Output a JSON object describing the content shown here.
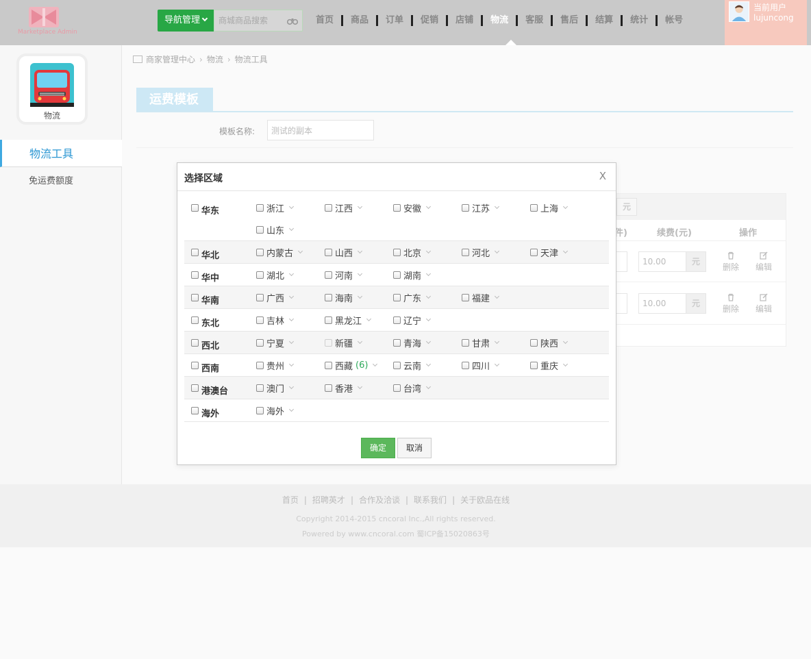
{
  "header": {
    "logo_text": "Marketplace Admin",
    "nav_button": "导航管理",
    "search_placeholder": "商城商品搜索",
    "nav_items": [
      "首页",
      "商品",
      "订单",
      "促销",
      "店铺",
      "物流",
      "客服",
      "售后",
      "结算",
      "统计",
      "帐号"
    ],
    "active_nav": "物流",
    "user_label": "当前用户",
    "user_name": "lujuncong",
    "user_icons": [
      "home-icon",
      "mail-icon",
      "wrench-icon",
      "logout-icon"
    ]
  },
  "sidebar": {
    "app_label": "物流",
    "active_item": "物流工具",
    "items": [
      "免运费额度"
    ]
  },
  "breadcrumb": [
    "商家管理中心",
    "物流",
    "物流工具"
  ],
  "main": {
    "section_title": "运费模板",
    "template_name_label": "模板名称:",
    "template_name_value": "测试的副本",
    "table": {
      "unit_badge": "元",
      "col_count": "件)",
      "col_fee": "续费(元)",
      "col_ops": "操作",
      "rows": [
        {
          "fee": "10.00",
          "unit": "元",
          "delete": "删除",
          "edit": "编辑"
        },
        {
          "fee": "10.00",
          "unit": "元",
          "delete": "删除",
          "edit": "编辑"
        }
      ]
    }
  },
  "modal": {
    "title": "选择区域",
    "close": "X",
    "regions": [
      {
        "name": "华东",
        "provinces": [
          {
            "name": "浙江"
          },
          {
            "name": "江西"
          },
          {
            "name": "安徽"
          },
          {
            "name": "江苏"
          },
          {
            "name": "上海"
          },
          {
            "name": "山东"
          }
        ]
      },
      {
        "name": "华北",
        "provinces": [
          {
            "name": "内蒙古"
          },
          {
            "name": "山西"
          },
          {
            "name": "北京"
          },
          {
            "name": "河北"
          },
          {
            "name": "天津"
          }
        ]
      },
      {
        "name": "华中",
        "provinces": [
          {
            "name": "湖北"
          },
          {
            "name": "河南"
          },
          {
            "name": "湖南"
          }
        ]
      },
      {
        "name": "华南",
        "provinces": [
          {
            "name": "广西"
          },
          {
            "name": "海南"
          },
          {
            "name": "广东"
          },
          {
            "name": "福建"
          }
        ]
      },
      {
        "name": "东北",
        "provinces": [
          {
            "name": "吉林"
          },
          {
            "name": "黑龙江"
          },
          {
            "name": "辽宁"
          }
        ]
      },
      {
        "name": "西北",
        "provinces": [
          {
            "name": "宁夏"
          },
          {
            "name": "新疆",
            "disabled": true
          },
          {
            "name": "青海"
          },
          {
            "name": "甘肃"
          },
          {
            "name": "陕西"
          }
        ]
      },
      {
        "name": "西南",
        "provinces": [
          {
            "name": "贵州"
          },
          {
            "name": "西藏",
            "count": "(6)"
          },
          {
            "name": "云南"
          },
          {
            "name": "四川"
          },
          {
            "name": "重庆"
          }
        ]
      },
      {
        "name": "港澳台",
        "provinces": [
          {
            "name": "澳门"
          },
          {
            "name": "香港"
          },
          {
            "name": "台湾"
          }
        ]
      },
      {
        "name": "海外",
        "provinces": [
          {
            "name": "海外"
          }
        ]
      }
    ],
    "confirm": "确定",
    "cancel": "取消"
  },
  "footer": {
    "links": [
      "首页",
      "招聘英才",
      "合作及洽谈",
      "联系我们",
      "关于欧品在线"
    ],
    "copyright": "Copyright 2014-2015 cncoral Inc.,All rights reserved.",
    "powered": "Powered by www.cncoral.com 蜀ICP备15020863号"
  },
  "colors": {
    "header_bg": "#c9c9c9",
    "nav_button": "#28a745",
    "user_box": "#f7c9be",
    "sidebar_accent": "#3fa9e1",
    "confirm_button": "#5cb85c",
    "count_green": "#2eaa5b"
  }
}
